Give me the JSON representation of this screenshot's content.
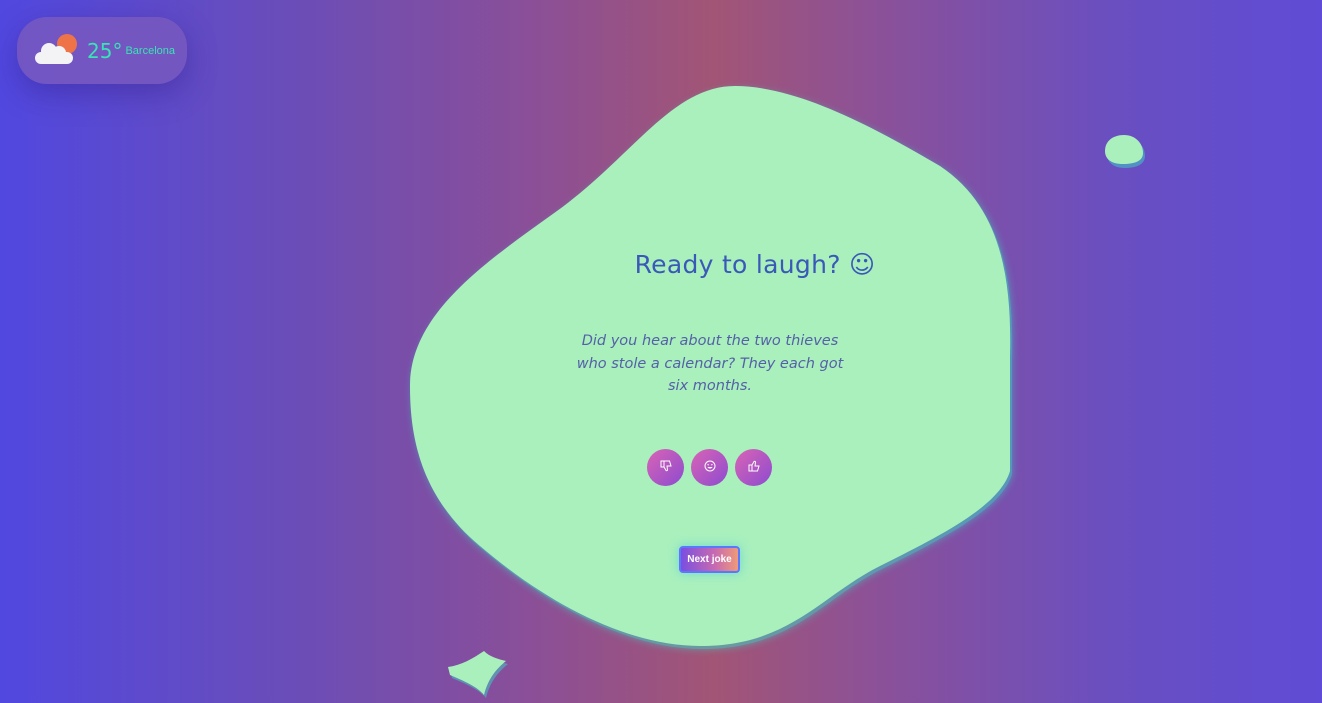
{
  "weather": {
    "temperature": "25°",
    "city": "Barcelona",
    "icon": "partly-cloudy-icon"
  },
  "card": {
    "title": "Ready to laugh? ☺",
    "joke": "Did you hear about the two thieves who stole a calendar? They each got six months."
  },
  "ratings": [
    {
      "icon": "thumbs-down-icon",
      "glyph": "👎"
    },
    {
      "icon": "laughing-face-icon",
      "glyph": "☺"
    },
    {
      "icon": "thumbs-up-icon",
      "glyph": "👍"
    }
  ],
  "next_button": {
    "label": "Next joke"
  },
  "colors": {
    "blob": "#a9f0bd",
    "blob_glow": "#3ad3c5",
    "title": "#3a58b8",
    "accent": "#39e3b5"
  }
}
